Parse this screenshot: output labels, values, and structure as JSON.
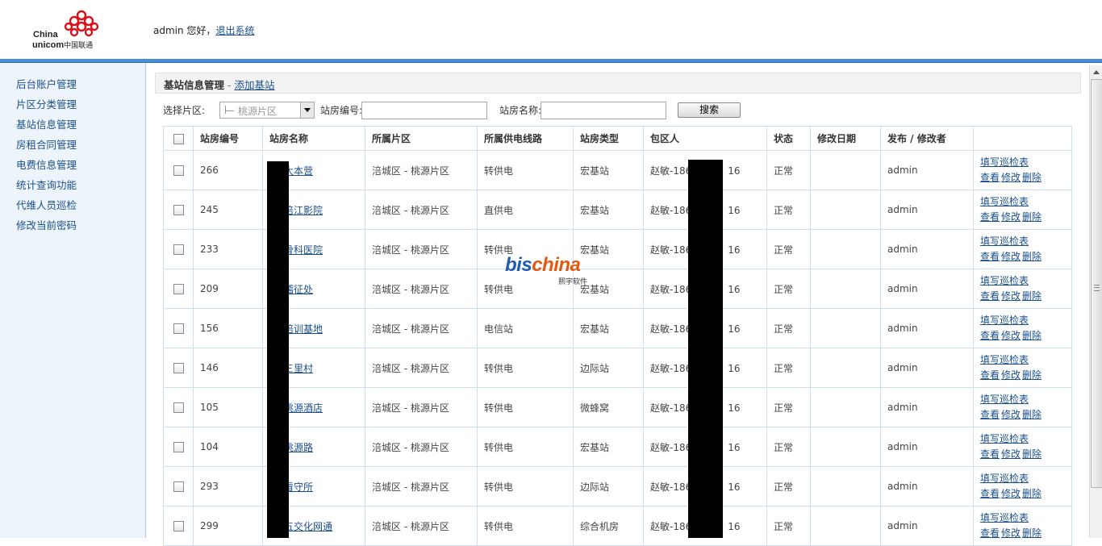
{
  "header": {
    "logo_line1": "China",
    "logo_line2": "unicom",
    "logo_line2_cn": "中国联通",
    "user": "admin",
    "greeting": " 您好，",
    "logout": "退出系统"
  },
  "sidebar": {
    "items": [
      {
        "label": "后台账户管理"
      },
      {
        "label": "片区分类管理"
      },
      {
        "label": "基站信息管理"
      },
      {
        "label": "房租合同管理"
      },
      {
        "label": "电费信息管理"
      },
      {
        "label": "统计查询功能"
      },
      {
        "label": "代维人员巡检"
      },
      {
        "label": "修改当前密码"
      }
    ]
  },
  "main": {
    "title": "基站信息管理",
    "sep": " - ",
    "add_link": "添加基站",
    "filters": {
      "area_label": "选择片区:",
      "area_value": "桃源片区",
      "code_label": "站房编号:",
      "code_value": "",
      "name_label": "站房名称:",
      "name_value": "",
      "search": "搜索"
    },
    "columns": [
      "站房编号",
      "站房名称",
      "所属片区",
      "所属供电线路",
      "站房类型",
      "包区人",
      "状态",
      "修改日期",
      "发布 / 修改者"
    ],
    "actions": {
      "fill": "填写巡检表",
      "view": "查看",
      "edit": "修改",
      "del": "删除"
    },
    "rows": [
      {
        "code": "266",
        "name": "大本营",
        "area": "涪城区 - 桃源片区",
        "line": "转供电",
        "type": "宏基站",
        "person": "赵敏-186",
        "tail": "16",
        "status": "正常",
        "date": "",
        "author": "admin"
      },
      {
        "code": "245",
        "name": "涪江影院",
        "area": "涪城区 - 桃源片区",
        "line": "直供电",
        "type": "宏基站",
        "person": "赵敏-186",
        "tail": "16",
        "status": "正常",
        "date": "",
        "author": "admin"
      },
      {
        "code": "233",
        "name": "骨科医院",
        "area": "涪城区 - 桃源片区",
        "line": "转供电",
        "type": "宏基站",
        "person": "赵敏-186",
        "tail": "16",
        "status": "正常",
        "date": "",
        "author": "admin"
      },
      {
        "code": "209",
        "name": "稽征处",
        "area": "涪城区 - 桃源片区",
        "line": "转供电",
        "type": "宏基站",
        "person": "赵敏-186",
        "tail": "16",
        "status": "正常",
        "date": "",
        "author": "admin"
      },
      {
        "code": "156",
        "name": "培训基地",
        "area": "涪城区 - 桃源片区",
        "line": "电信站",
        "type": "宏基站",
        "person": "赵敏-186",
        "tail": "16",
        "status": "正常",
        "date": "",
        "author": "admin"
      },
      {
        "code": "146",
        "name": "三里村",
        "area": "涪城区 - 桃源片区",
        "line": "转供电",
        "type": "边际站",
        "person": "赵敏-186",
        "tail": "16",
        "status": "正常",
        "date": "",
        "author": "admin"
      },
      {
        "code": "105",
        "name": "桃源酒店",
        "area": "涪城区 - 桃源片区",
        "line": "转供电",
        "type": "微蜂窝",
        "person": "赵敏-186",
        "tail": "16",
        "status": "正常",
        "date": "",
        "author": "admin"
      },
      {
        "code": "104",
        "name": "桃源路",
        "area": "涪城区 - 桃源片区",
        "line": "转供电",
        "type": "宏基站",
        "person": "赵敏-186",
        "tail": "16",
        "status": "正常",
        "date": "",
        "author": "admin"
      },
      {
        "code": "293",
        "name": "看守所",
        "area": "涪城区 - 桃源片区",
        "line": "转供电",
        "type": "边际站",
        "person": "赵敏-186",
        "tail": "16",
        "status": "正常",
        "date": "",
        "author": "admin"
      },
      {
        "code": "299",
        "name": "五交化网通",
        "area": "涪城区 - 桃源片区",
        "line": "转供电",
        "type": "综合机房",
        "person": "赵敏-186",
        "tail": "16",
        "status": "正常",
        "date": "",
        "author": "admin"
      }
    ]
  },
  "watermark": {
    "brand_a": "bis",
    "brand_b": "china",
    "sub": "熙宇软件"
  },
  "colors": {
    "accent": "#4a8ed6",
    "link": "#1a4f8b",
    "sidebar_bg": "#eef4fb",
    "logo_red": "#d6121b"
  }
}
